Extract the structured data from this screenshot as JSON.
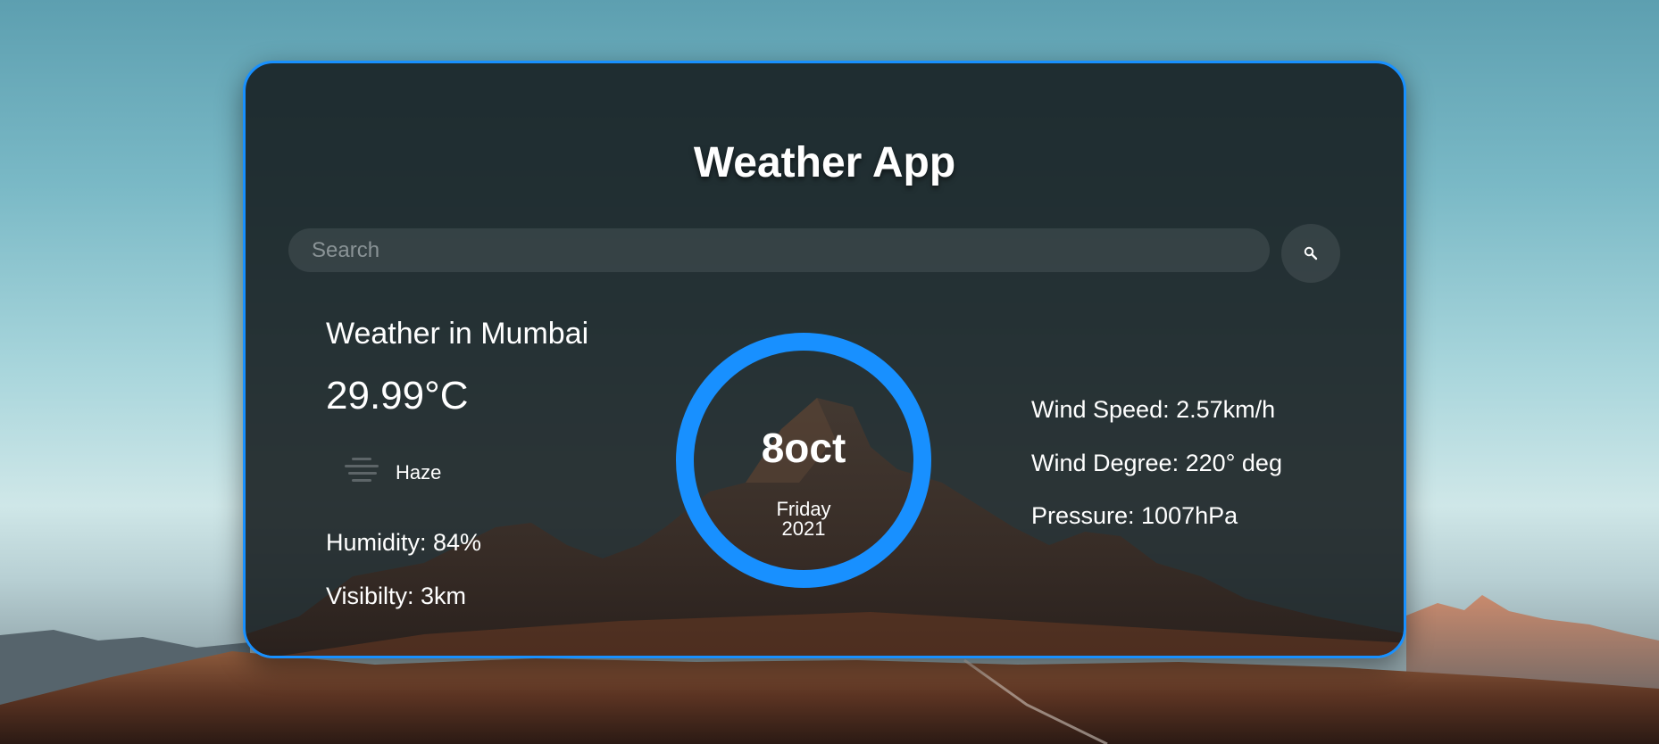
{
  "app": {
    "title": "Weather App"
  },
  "search": {
    "placeholder": "Search",
    "button_icon": "search-icon"
  },
  "weather": {
    "city_heading": "Weather in Mumbai",
    "temperature": "29.99°C",
    "condition": "Haze",
    "condition_icon": "haze-icon",
    "humidity": "Humidity: 84%",
    "visibility": "Visibilty: 3km"
  },
  "date": {
    "day_month": "8oct",
    "weekday": "Friday",
    "year": "2021"
  },
  "details": {
    "wind_speed": "Wind Speed: 2.57km/h",
    "wind_degree": "Wind Degree: 220° deg",
    "pressure": "Pressure: 1007hPa"
  },
  "colors": {
    "accent": "#1890ff",
    "card_bg": "#141b1e",
    "text": "#ffffff"
  }
}
